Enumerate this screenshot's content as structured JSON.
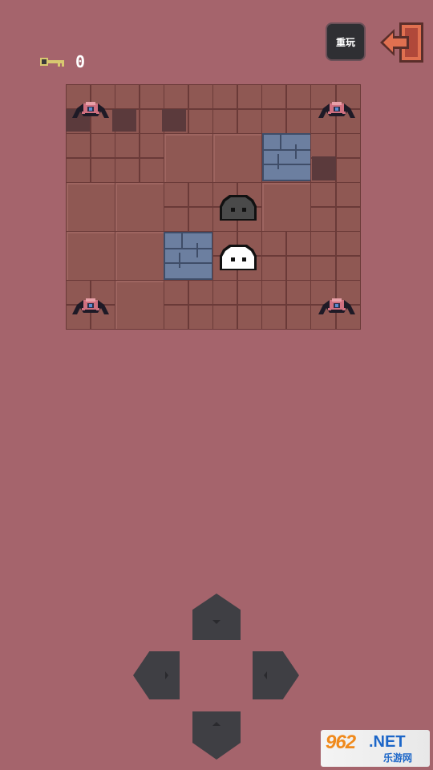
{
  "hud": {
    "keys_count": "0",
    "replay_label": "重玩"
  },
  "board": {
    "cols": 6,
    "rows": 5,
    "player": {
      "col": 3,
      "row": 3,
      "color": "#ffffff"
    },
    "slime": {
      "col": 3,
      "row": 2,
      "color": "#4a4a4a"
    },
    "spiders": [
      {
        "col": 0,
        "row": 0
      },
      {
        "col": 5,
        "row": 0
      },
      {
        "col": 0,
        "row": 4
      },
      {
        "col": 5,
        "row": 4
      }
    ]
  },
  "colors": {
    "background": "#a5646c",
    "floor": "#8f5853",
    "stone": "#6c7fa0",
    "exit": "#e07050",
    "dpad": "#3f3f44"
  },
  "watermark": {
    "brand": "962",
    "brand_suffix": ".NET",
    "sub": "乐游网"
  }
}
